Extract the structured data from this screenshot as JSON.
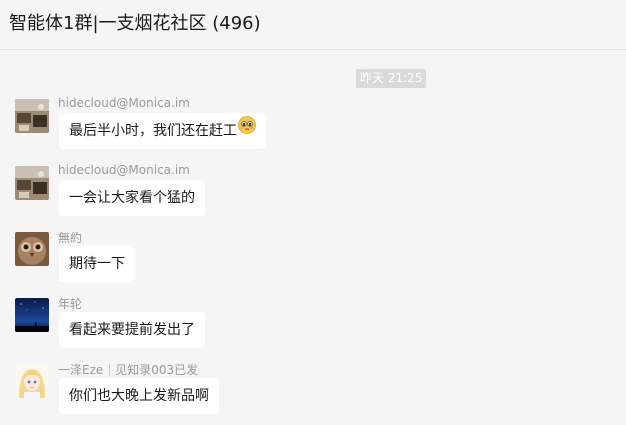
{
  "header": {
    "title": "智能体1群|一支烟花社区 (496)"
  },
  "timestamp": "昨天 21:25",
  "messages": [
    {
      "sender": "hidecloud@Monica.im",
      "text": "最后半小时，我们还在赶工",
      "avatar": "desk-photo-avatar",
      "emoji": "pleading-face-emoji"
    },
    {
      "sender": "hidecloud@Monica.im",
      "text": "一会让大家看个猛的",
      "avatar": "desk-photo-avatar"
    },
    {
      "sender": "無約",
      "text": "期待一下",
      "avatar": "owl-avatar"
    },
    {
      "sender": "年轮",
      "text": "看起来要提前发出了",
      "avatar": "night-sky-avatar"
    },
    {
      "sender": "一泽Eze｜见知录003已发",
      "text": "你们也大晚上发新品啊",
      "avatar": "anime-girl-avatar"
    }
  ]
}
